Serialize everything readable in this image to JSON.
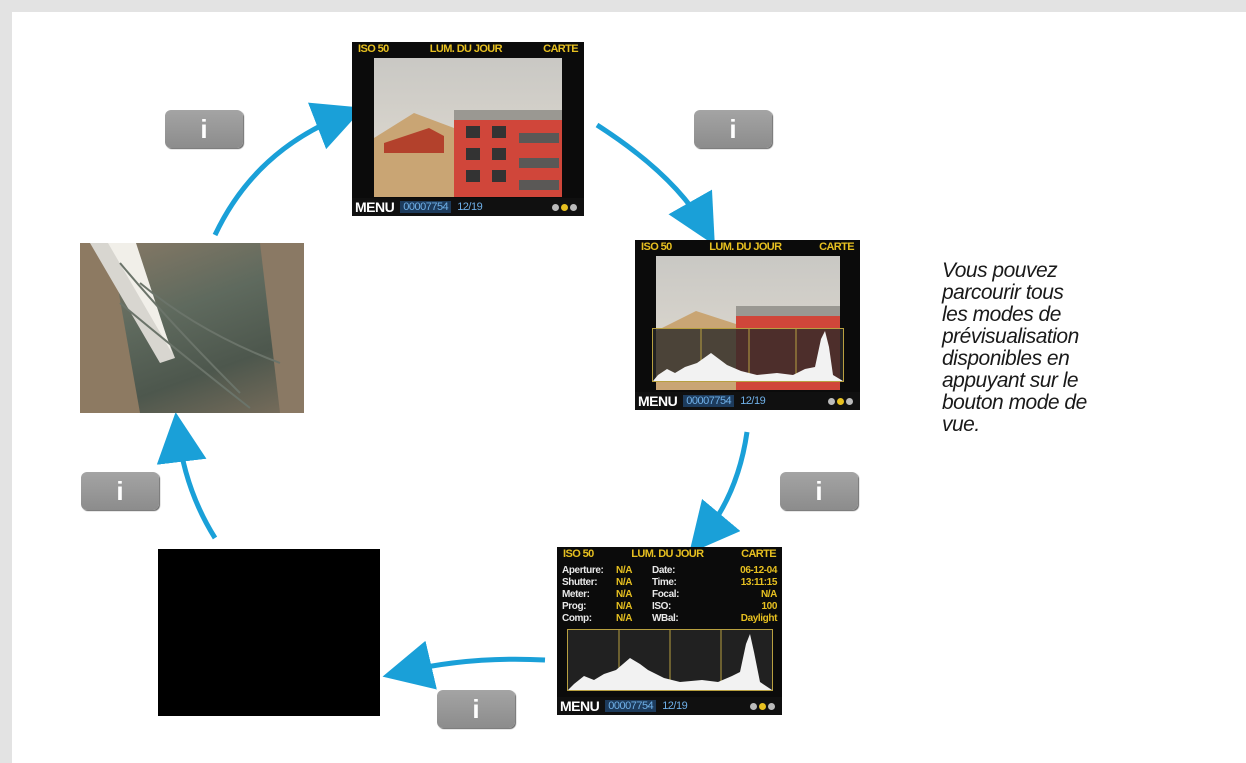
{
  "screen_top": {
    "iso": "ISO 50",
    "wb": "LUM. DU JOUR",
    "media": "CARTE"
  },
  "screen_bottom": {
    "menu": "MENU",
    "file_id": "00007754",
    "count": "12/19"
  },
  "info_button": {
    "glyph": "i"
  },
  "info_table": {
    "rows": [
      {
        "k1": "Aperture:",
        "v1": "N/A",
        "k2": "Date:",
        "v2": "06-12-04"
      },
      {
        "k1": "Shutter:",
        "v1": "N/A",
        "k2": "Time:",
        "v2": "13:11:15"
      },
      {
        "k1": "Meter:",
        "v1": "N/A",
        "k2": "Focal:",
        "v2": "N/A"
      },
      {
        "k1": "Prog:",
        "v1": "N/A",
        "k2": "ISO:",
        "v2": "100"
      },
      {
        "k1": "Comp:",
        "v1": "N/A",
        "k2": "WBal:",
        "v2": "Daylight"
      }
    ]
  },
  "description": {
    "lines": [
      "Vous pouvez",
      "parcourir tous",
      "les modes de",
      "prévisualisation",
      "disponibles en",
      "appuyant sur le",
      "bouton mode de",
      "vue."
    ]
  },
  "colors": {
    "arrow": "#1aa0d8",
    "accent_yellow": "#e7c020",
    "info_button": "#999999"
  }
}
